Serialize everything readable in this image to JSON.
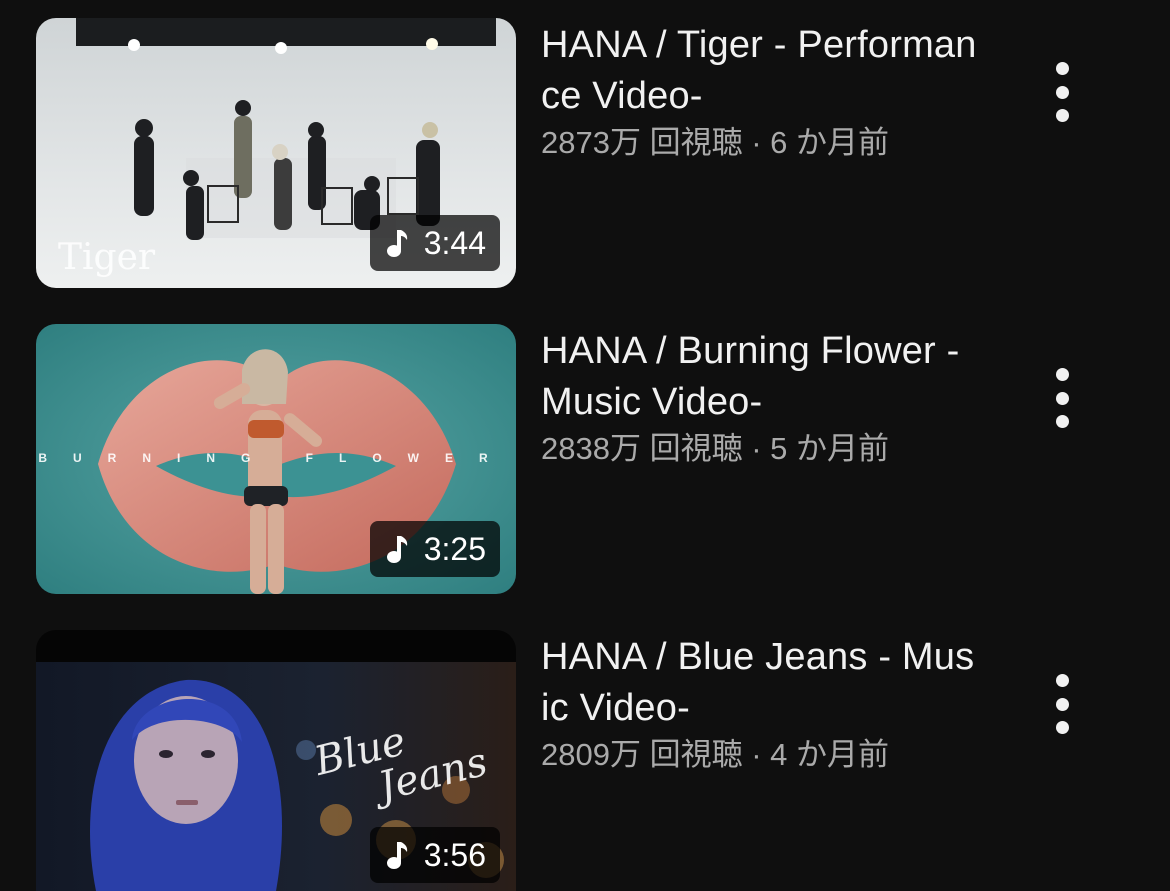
{
  "videos": [
    {
      "title": "HANA / Tiger - Performance Video-",
      "meta": "2873万 回視聴 · 6 か月前",
      "duration": "3:44",
      "thumb_caption": "Tiger",
      "duration_icon": "music-note-icon"
    },
    {
      "title": "HANA / Burning Flower -Music Video-",
      "meta": "2838万 回視聴 · 5 か月前",
      "duration": "3:25",
      "thumb_caption": "BURNING FLOWER",
      "duration_icon": "music-note-icon"
    },
    {
      "title": "HANA / Blue Jeans - Music Video-",
      "meta": "2809万 回視聴 · 4 か月前",
      "duration": "3:56",
      "thumb_caption_line1": "Blue",
      "thumb_caption_line2": "Jeans",
      "duration_icon": "music-note-icon"
    }
  ],
  "more_icon": "more-vertical-icon",
  "colors": {
    "background": "#0f0f0f",
    "title": "#f1f1f1",
    "meta": "#aaaaaa"
  }
}
